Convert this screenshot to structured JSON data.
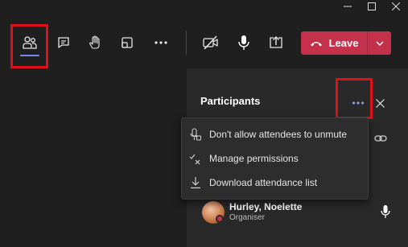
{
  "toolbar": {
    "buttons": [
      {
        "icon": "participants-icon",
        "active": true
      },
      {
        "icon": "chat-icon"
      },
      {
        "icon": "raise-hand-icon"
      },
      {
        "icon": "breakout-rooms-icon"
      },
      {
        "icon": "more-actions-icon"
      },
      {
        "icon": "camera-off-icon"
      },
      {
        "icon": "microphone-icon"
      },
      {
        "icon": "share-screen-icon"
      }
    ],
    "leave_label": "Leave"
  },
  "panel": {
    "title": "Participants"
  },
  "menu": {
    "items": [
      {
        "label": "Don't allow attendees to unmute",
        "icon": "mic-lock-icon"
      },
      {
        "label": "Manage permissions",
        "icon": "permissions-icon"
      },
      {
        "label": "Download attendance list",
        "icon": "download-icon"
      }
    ]
  },
  "participants": [
    {
      "name": "Hurley, Noelette",
      "role": "Organiser"
    }
  ],
  "colors": {
    "background": "#1f1f1f",
    "panel": "#292929",
    "leave": "#c4314b",
    "accent": "#7f85f5",
    "highlight": "#e0101a"
  }
}
